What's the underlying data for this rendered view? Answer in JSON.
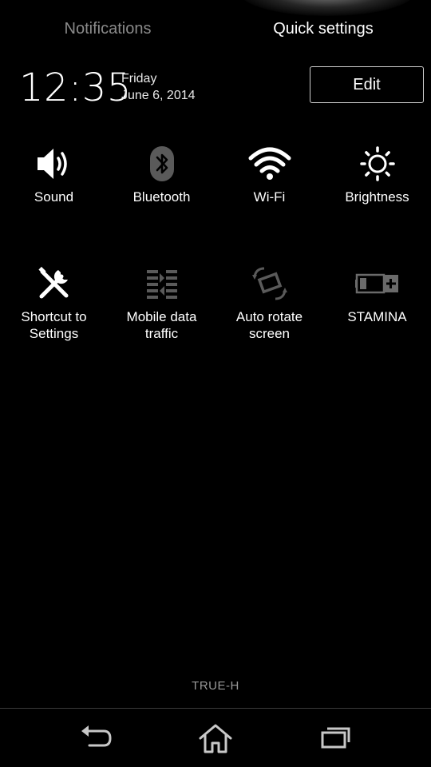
{
  "tabs": {
    "notifications": "Notifications",
    "quick_settings": "Quick settings"
  },
  "clock": {
    "time": "12:35",
    "day": "Friday",
    "date": "June 6, 2014"
  },
  "edit_label": "Edit",
  "tiles": [
    {
      "label": "Sound",
      "icon": "speaker-icon",
      "state": "on"
    },
    {
      "label": "Bluetooth",
      "icon": "bluetooth-icon",
      "state": "off"
    },
    {
      "label": "Wi-Fi",
      "icon": "wifi-icon",
      "state": "on"
    },
    {
      "label": "Brightness",
      "icon": "brightness-icon",
      "state": "on"
    },
    {
      "label": "Shortcut to\nSettings",
      "icon": "tools-icon",
      "state": "on"
    },
    {
      "label": "Mobile data\ntraffic",
      "icon": "data-traffic-icon",
      "state": "off"
    },
    {
      "label": "Auto rotate\nscreen",
      "icon": "rotate-icon",
      "state": "off"
    },
    {
      "label": "STAMINA",
      "icon": "battery-icon",
      "state": "off"
    }
  ],
  "operator": "TRUE-H",
  "navigation": {
    "back": "back-icon",
    "home": "home-icon",
    "recent": "recent-apps-icon"
  },
  "colors": {
    "background": "#000000",
    "active_icon": "#ffffff",
    "inactive_icon": "#5a5a5a",
    "inactive_tab": "#8a8a8a"
  }
}
